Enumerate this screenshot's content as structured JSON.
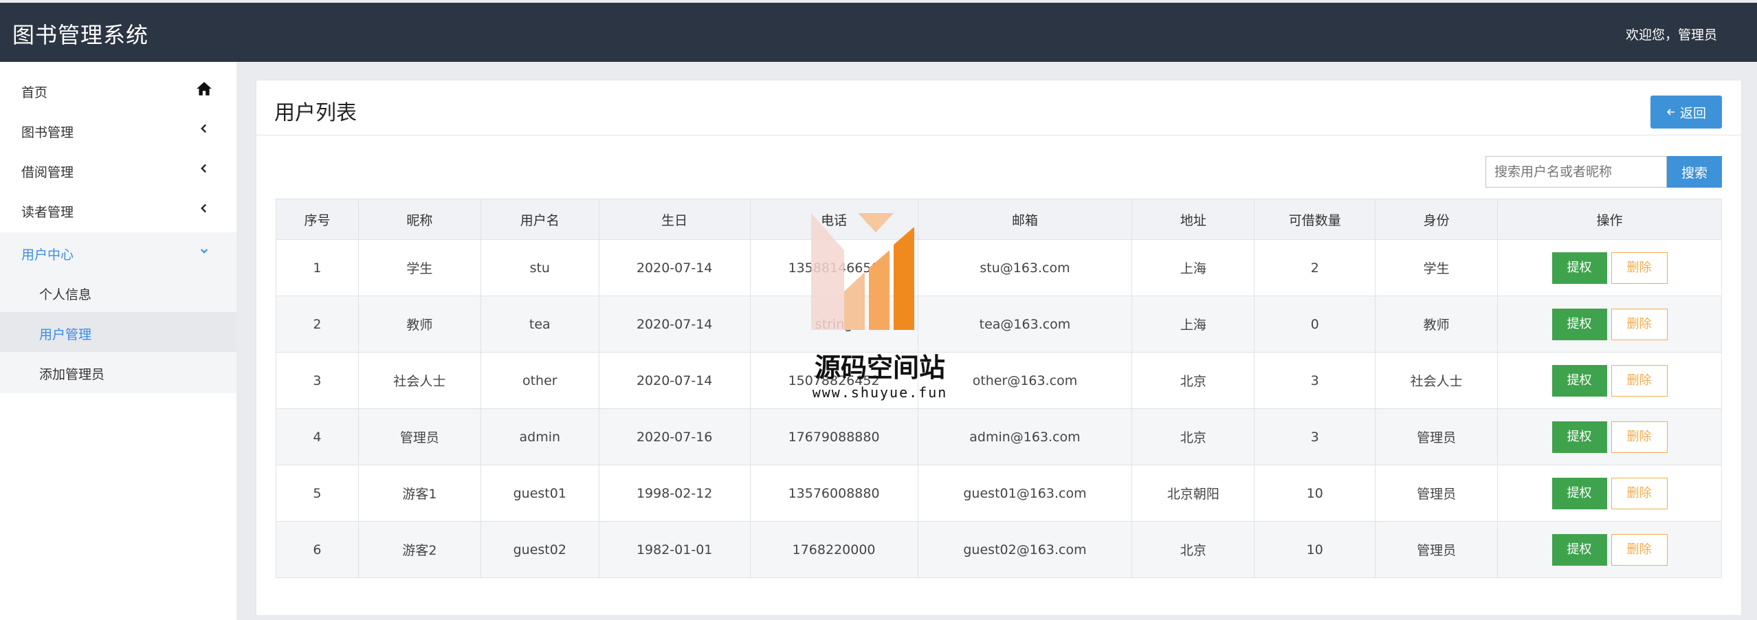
{
  "header": {
    "title": "图书管理系统",
    "welcome": "欢迎您，管理员"
  },
  "sidebar": {
    "items": [
      {
        "label": "首页",
        "icon": "home-icon"
      },
      {
        "label": "图书管理",
        "icon": "chevron-left-icon"
      },
      {
        "label": "借阅管理",
        "icon": "chevron-left-icon"
      },
      {
        "label": "读者管理",
        "icon": "chevron-left-icon"
      },
      {
        "label": "用户中心",
        "icon": "chevron-down-icon",
        "active": true
      }
    ],
    "sub_items": [
      {
        "label": "个人信息"
      },
      {
        "label": "用户管理",
        "current": true
      },
      {
        "label": "添加管理员"
      }
    ]
  },
  "main": {
    "title": "用户列表",
    "back_label": "返回",
    "search": {
      "placeholder": "搜索用户名或者昵称",
      "button_label": "搜索"
    },
    "table": {
      "headers": [
        "序号",
        "昵称",
        "用户名",
        "生日",
        "电话",
        "邮箱",
        "地址",
        "可借数量",
        "身份",
        "操作"
      ],
      "rows": [
        [
          "1",
          "学生",
          "stu",
          "2020-07-14",
          "13588146650",
          "stu@163.com",
          "上海",
          "2",
          "学生"
        ],
        [
          "2",
          "教师",
          "tea",
          "2020-07-14",
          "string",
          "tea@163.com",
          "上海",
          "0",
          "教师"
        ],
        [
          "3",
          "社会人士",
          "other",
          "2020-07-14",
          "15078826452",
          "other@163.com",
          "北京",
          "3",
          "社会人士"
        ],
        [
          "4",
          "管理员",
          "admin",
          "2020-07-16",
          "17679088880",
          "admin@163.com",
          "北京",
          "3",
          "管理员"
        ],
        [
          "5",
          "游客1",
          "guest01",
          "1998-02-12",
          "13576008880",
          "guest01@163.com",
          "北京朝阳",
          "10",
          "管理员"
        ],
        [
          "6",
          "游客2",
          "guest02",
          "1982-01-01",
          "1768220000",
          "guest02@163.com",
          "北京",
          "10",
          "管理员"
        ]
      ],
      "action_labels": {
        "authorize": "提权",
        "delete": "删除"
      }
    }
  },
  "watermark": {
    "title": "源码空间站",
    "url": "www.shuyue.fun"
  },
  "colors": {
    "topbar": "#2c3543",
    "accent": "#3e92d8",
    "success": "#3fa34d",
    "warning": "#f0ad4e"
  }
}
